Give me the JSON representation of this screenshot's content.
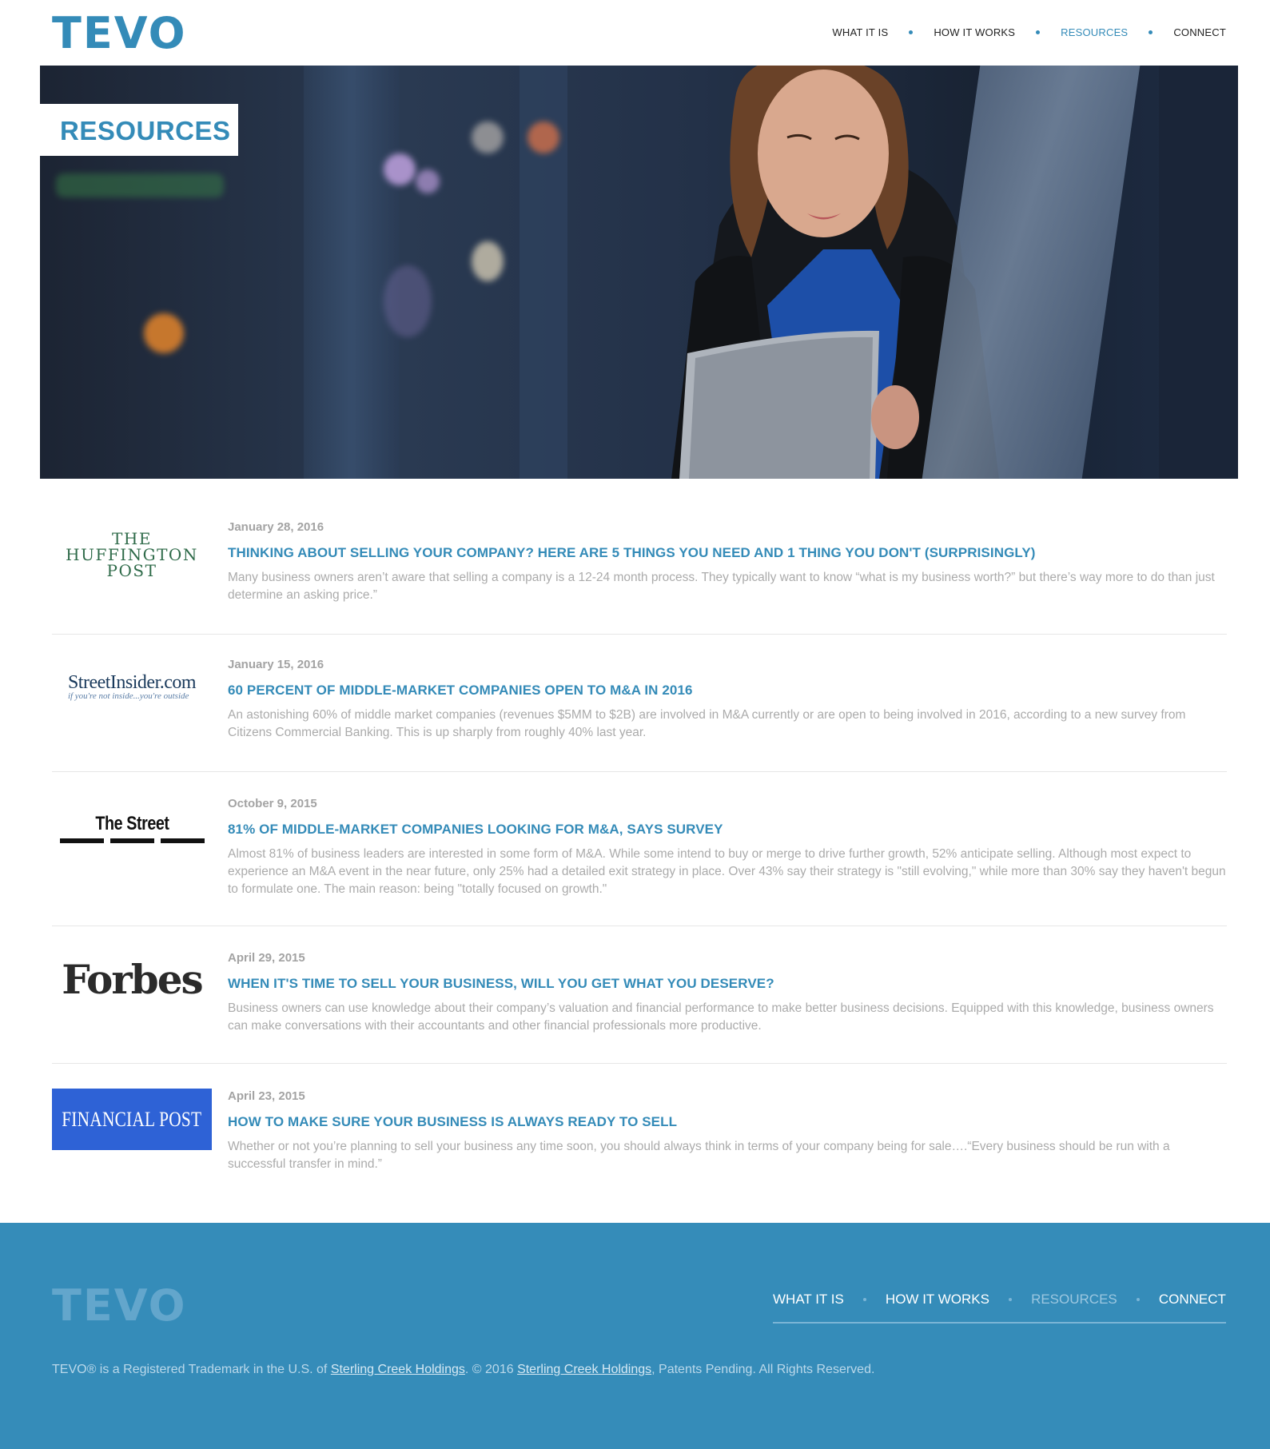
{
  "brand": {
    "logo_text": "TEVO",
    "accent_color": "#348bb8",
    "footer_bg": "#358cb9"
  },
  "nav": {
    "items": [
      {
        "label": "WHAT IT IS"
      },
      {
        "label": "HOW IT WORKS"
      },
      {
        "label": "RESOURCES",
        "active": true
      },
      {
        "label": "CONNECT"
      }
    ]
  },
  "hero": {
    "title": "RESOURCES",
    "image_icon": "hero-photo-woman-with-tablet"
  },
  "articles": [
    {
      "source": "THE HUFFINGTON POST",
      "source_lines": [
        "THE",
        "HUFFINGTON",
        "POST"
      ],
      "date": "January 28, 2016",
      "title": "THINKING ABOUT SELLING YOUR COMPANY? HERE ARE 5 THINGS YOU NEED AND 1 THING YOU DON'T (SURPRISINGLY)",
      "excerpt": "Many business owners aren’t aware that selling a company is a 12-24 month process. They typically want to know “what is my business worth?” but there’s way more to do than just determine an asking price.”"
    },
    {
      "source": "StreetInsider.com",
      "source_tagline": "if you're not inside...you're outside",
      "date": "January 15, 2016",
      "title": "60 PERCENT OF MIDDLE-MARKET COMPANIES OPEN TO M&A IN 2016",
      "excerpt": "An astonishing 60% of middle market companies (revenues $5MM to $2B) are involved in M&A currently or are open to being involved in 2016, according to a new survey from Citizens Commercial Banking. This is up sharply from roughly 40% last year."
    },
    {
      "source": "The Street",
      "date": "October 9, 2015",
      "title": "81% OF MIDDLE-MARKET COMPANIES LOOKING FOR M&A, SAYS SURVEY",
      "excerpt": "Almost 81% of business leaders are interested in some form of M&A. While some intend to buy or merge to drive further growth, 52% anticipate selling. Although most expect to experience an M&A event in the near future, only 25% had a detailed exit strategy in place. Over 43% say their strategy is \"still evolving,\" while more than 30% say they haven't begun to formulate one. The main reason: being \"totally focused on growth.\""
    },
    {
      "source": "Forbes",
      "date": "April 29, 2015",
      "title": "WHEN IT'S TIME TO SELL YOUR BUSINESS, WILL YOU GET WHAT YOU DESERVE?",
      "excerpt": "Business owners can use knowledge about their company’s valuation and financial performance to make better business decisions. Equipped with this knowledge, business owners can make conversations with their accountants and other financial professionals more productive."
    },
    {
      "source": "FINANCIAL POST",
      "date": "April 23, 2015",
      "title": "HOW TO MAKE SURE YOUR BUSINESS IS ALWAYS READY TO SELL",
      "excerpt": "Whether or not you’re planning to sell your business any time soon, you should always think in terms of your company being for sale….“Every business should be run with a successful transfer in mind.”"
    }
  ],
  "footer": {
    "logo_text": "TEVO",
    "nav": [
      {
        "label": "WHAT IT IS"
      },
      {
        "label": "HOW IT WORKS"
      },
      {
        "label": "RESOURCES",
        "active": true
      },
      {
        "label": "CONNECT"
      }
    ],
    "legal_prefix": "TEVO® is a Registered Trademark in the U.S. of ",
    "legal_link1": "Sterling Creek Holdings",
    "legal_middle": ". © 2016 ",
    "legal_link2": "Sterling Creek Holdings",
    "legal_suffix": ", Patents Pending. All Rights Reserved."
  }
}
